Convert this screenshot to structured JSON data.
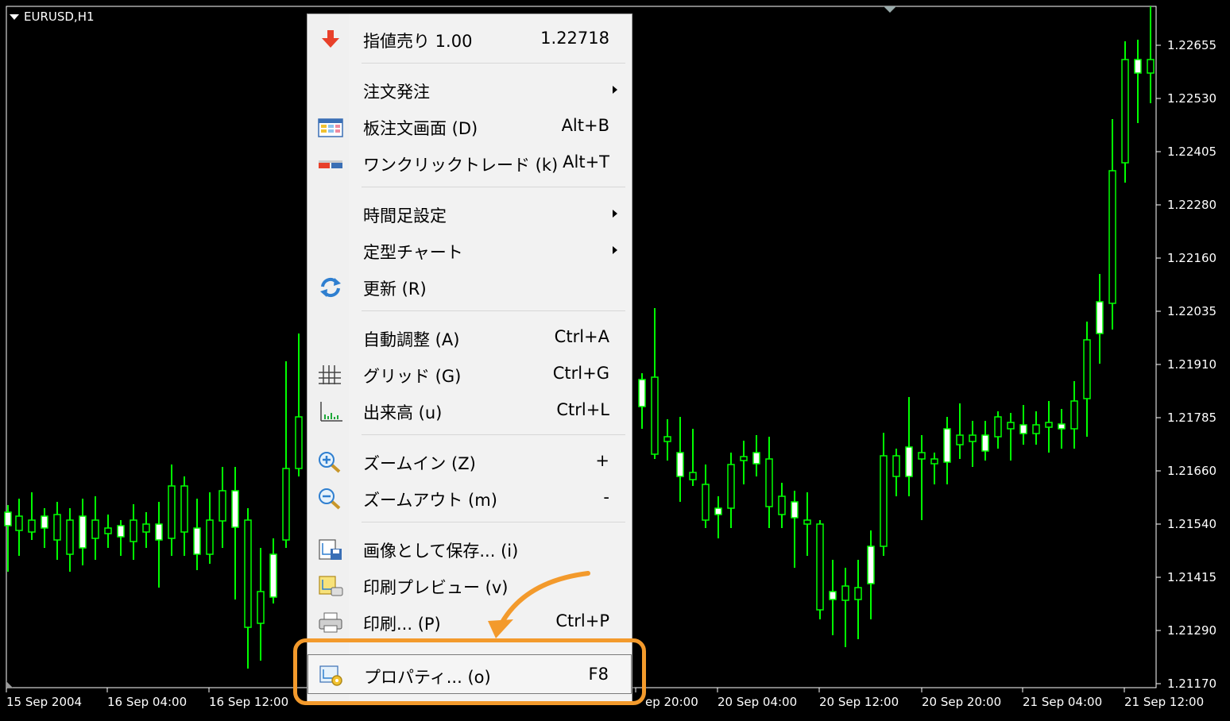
{
  "chart": {
    "symbol": "EURUSD,H1",
    "price_axis": [
      "1.22655",
      "1.22530",
      "1.22405",
      "1.22280",
      "1.22160",
      "1.22035",
      "1.21910",
      "1.21785",
      "1.21660",
      "1.21540",
      "1.21415",
      "1.21290",
      "1.21170"
    ],
    "time_axis": [
      "15 Sep 2004",
      "16 Sep 04:00",
      "16 Sep 12:00",
      "ep 20:00",
      "20 Sep 04:00",
      "20 Sep 12:00",
      "20 Sep 20:00",
      "21 Sep 04:00",
      "21 Sep 12:00"
    ],
    "colors": {
      "background": "#000000",
      "bull_candle": "#000000",
      "bear_candle": "#ffffff",
      "wick": "#00ff00"
    }
  },
  "menu": {
    "items": [
      {
        "label": "指値売り 1.00",
        "shortcut": "1.22718",
        "icon": "sell-limit-arrow-icon"
      },
      {
        "label": "注文発注",
        "shortcut": "",
        "submenu": true
      },
      {
        "label": "板注文画面 (D)",
        "shortcut": "Alt+B",
        "icon": "depth-of-market-icon"
      },
      {
        "label": "ワンクリックトレード (k)",
        "shortcut": "Alt+T",
        "icon": "one-click-trading-icon"
      },
      {
        "label": "時間足設定",
        "shortcut": "",
        "submenu": true
      },
      {
        "label": "定型チャート",
        "shortcut": "",
        "submenu": true
      },
      {
        "label": "更新 (R)",
        "shortcut": "",
        "icon": "refresh-icon"
      },
      {
        "label": "自動調整 (A)",
        "shortcut": "Ctrl+A"
      },
      {
        "label": "グリッド (G)",
        "shortcut": "Ctrl+G",
        "icon": "grid-icon"
      },
      {
        "label": "出来高 (u)",
        "shortcut": "Ctrl+L",
        "icon": "volumes-icon"
      },
      {
        "label": "ズームイン (Z)",
        "shortcut": "+",
        "icon": "zoom-in-icon"
      },
      {
        "label": "ズームアウト (m)",
        "shortcut": "-",
        "icon": "zoom-out-icon"
      },
      {
        "label": "画像として保存... (i)",
        "shortcut": "",
        "icon": "save-image-icon"
      },
      {
        "label": "印刷プレビュー (v)",
        "shortcut": "",
        "icon": "print-preview-icon"
      },
      {
        "label": "印刷... (P)",
        "shortcut": "Ctrl+P",
        "icon": "printer-icon"
      },
      {
        "label": "プロパティ... (o)",
        "shortcut": "F8",
        "icon": "properties-icon"
      }
    ]
  },
  "annotation": {
    "color": "#f39a2c"
  }
}
